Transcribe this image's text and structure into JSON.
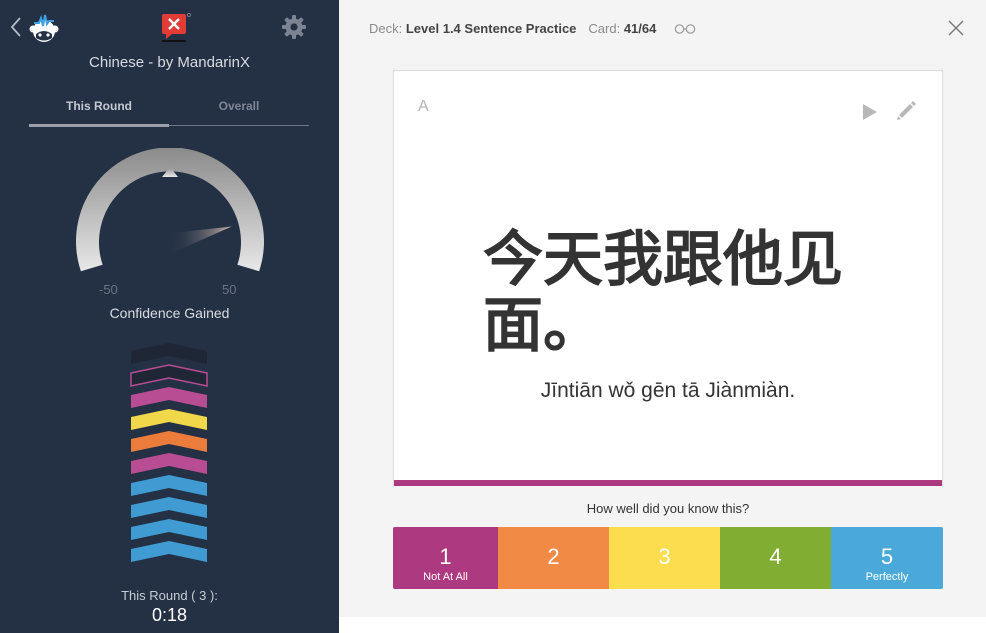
{
  "sidebar": {
    "back_icon": "chevron-left-icon",
    "app_logo_icon": "robot-logo-icon",
    "brand_logo_icon": "mandarinx-logo-icon",
    "settings_icon": "gear-icon",
    "deck_title": "Chinese - by MandarinX",
    "tabs": [
      {
        "label": "This Round",
        "active": true
      },
      {
        "label": "Overall",
        "active": false
      }
    ],
    "gauge": {
      "min_label": "-50",
      "max_label": "50",
      "min": -50,
      "max": 50,
      "value": 38,
      "title": "Confidence Gained"
    },
    "confidence_stack": {
      "levels": [
        {
          "state": "empty",
          "color": "#1f2737"
        },
        {
          "state": "current",
          "color": "#1f2737",
          "outline": "#b84d94"
        },
        {
          "state": "rated-1",
          "color": "#b84d94"
        },
        {
          "state": "rated-3",
          "color": "#f1d84a"
        },
        {
          "state": "rated-2",
          "color": "#ec7c3c"
        },
        {
          "state": "rated-1",
          "color": "#b84d94"
        },
        {
          "state": "rated-5",
          "color": "#3f9bd2"
        },
        {
          "state": "rated-5",
          "color": "#3f9bd2"
        },
        {
          "state": "rated-5",
          "color": "#3f9bd2"
        },
        {
          "state": "rated-5",
          "color": "#3f9bd2"
        }
      ]
    },
    "round_label": "This Round ( 3 ):",
    "round_time": "0:18"
  },
  "header": {
    "deck_prefix": "Deck:",
    "deck_name": "Level 1.4 Sentence Practice",
    "card_prefix": "Card:",
    "card_position": "41/64",
    "browse_icon": "glasses-icon",
    "close_icon": "close-icon"
  },
  "card": {
    "side": "A",
    "play_icon": "play-icon",
    "edit_icon": "pencil-icon",
    "hanzi": "今天我跟他见面。",
    "pinyin": "Jīntiān wǒ gēn tā Jiànmiàn.",
    "accent_color": "#ad3a80"
  },
  "rating": {
    "prompt": "How well did you know this?",
    "buttons": [
      {
        "number": "1",
        "label": "Not At All",
        "color": "#ad3a80"
      },
      {
        "number": "2",
        "label": "",
        "color": "#f08a44"
      },
      {
        "number": "3",
        "label": "",
        "color": "#fbdd4e"
      },
      {
        "number": "4",
        "label": "",
        "color": "#81ae32"
      },
      {
        "number": "5",
        "label": "Perfectly",
        "color": "#4aa9d8"
      }
    ]
  }
}
